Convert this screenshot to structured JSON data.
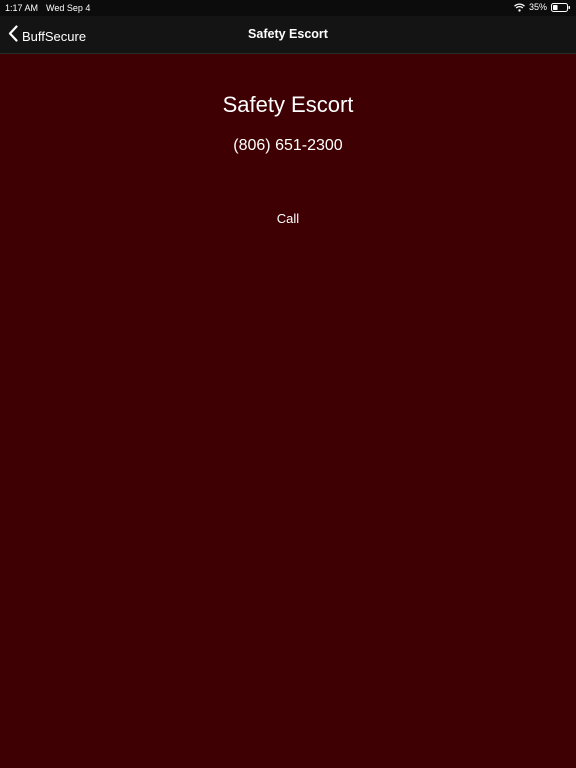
{
  "status_bar": {
    "time": "1:17 AM",
    "date": "Wed Sep 4",
    "battery_percent": "35%",
    "battery_level": 0.35,
    "wifi_icon": "wifi-icon",
    "battery_icon": "battery-icon"
  },
  "nav": {
    "back_label": "BuffSecure",
    "back_icon": "chevron-left-icon",
    "title": "Safety Escort"
  },
  "main": {
    "title": "Safety Escort",
    "phone": "(806) 651-2300",
    "call_label": "Call"
  },
  "colors": {
    "background": "#3e0003",
    "nav_bar": "#141414",
    "text": "#ffffff"
  }
}
